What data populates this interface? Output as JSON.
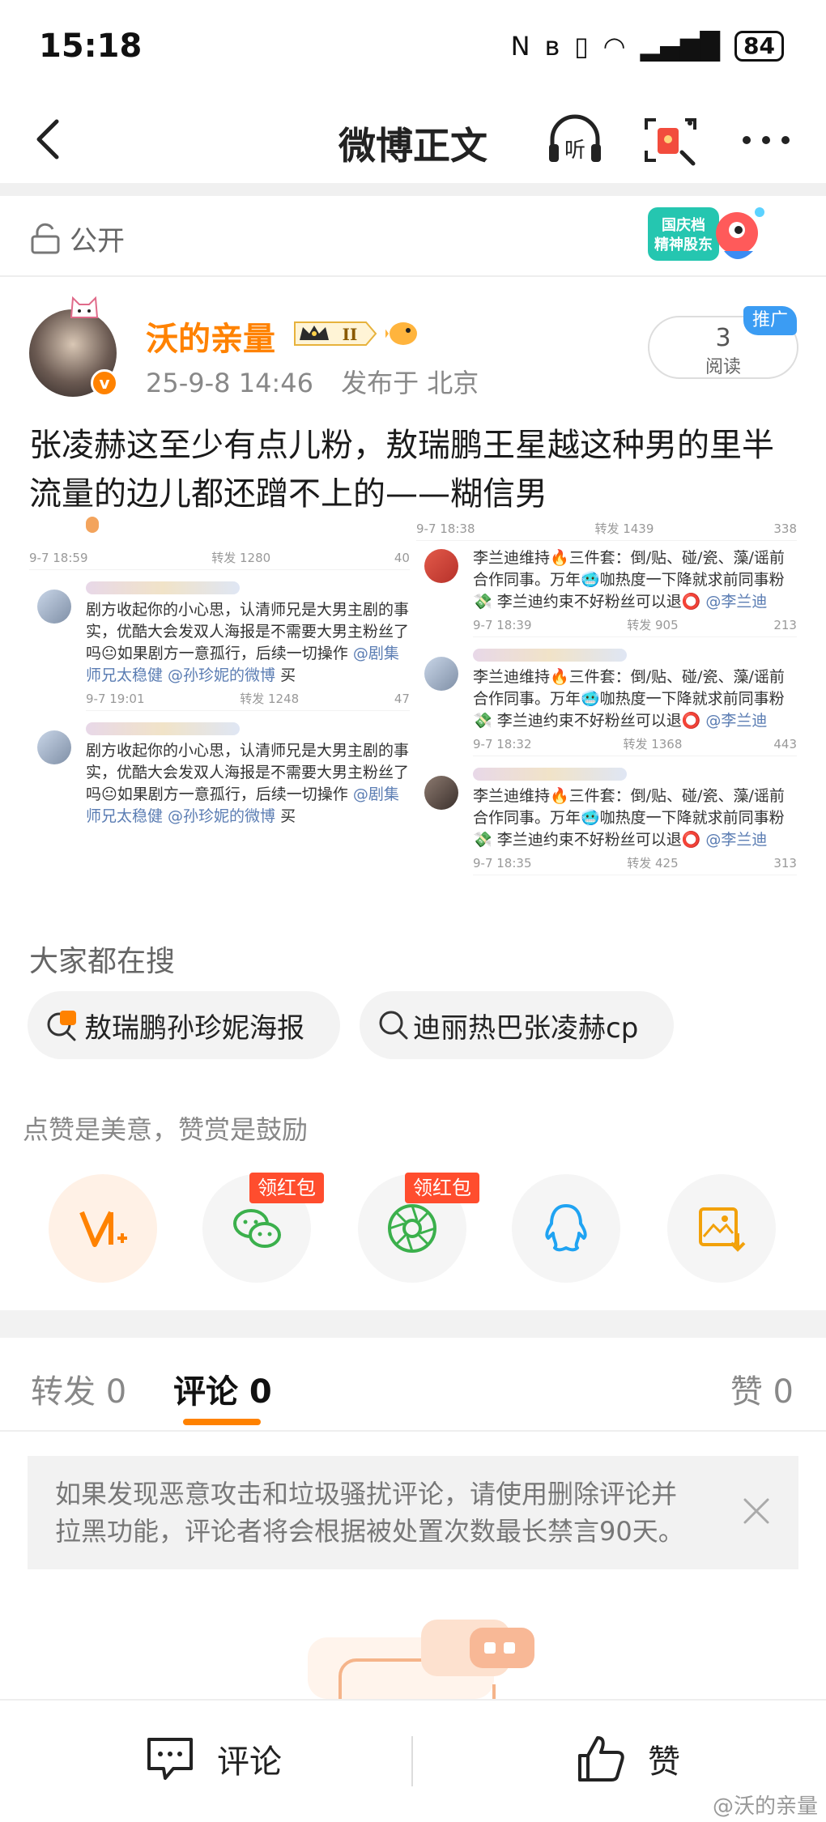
{
  "status_bar": {
    "time": "15:18",
    "battery": "84"
  },
  "nav": {
    "title": "微博正文",
    "listen_label": "听"
  },
  "visibility": {
    "label": "公开"
  },
  "promo_badge": {
    "line1": "国庆档",
    "line2": "精神股东"
  },
  "author": {
    "name": "沃的亲量",
    "level": "II",
    "time": "25-9-8 14:46",
    "location": "发布于 北京"
  },
  "reads": {
    "count": "3",
    "label": "阅读",
    "promo_tag": "推广"
  },
  "post": {
    "text": "张凌赫这至少有点儿粉，敖瑞鹏王星越这种男的里半流量的边儿都还蹭不上的——糊信男"
  },
  "screenshot_left": {
    "top_meta": [
      "9-7 18:59",
      "转发 1280",
      "40"
    ],
    "comment1": {
      "text": "剧方收起你的小心思，认清师兄是大男主剧的事实，优酷大会发双人海报是不需要大男主粉丝了吗😐如果剧方一意孤行，后续一切操作",
      "mention": "@剧集师兄太稳健 @孙珍妮的微博",
      "tail": "买",
      "meta": [
        "9-7 19:01",
        "转发 1248",
        "47"
      ]
    },
    "comment2": {
      "text": "剧方收起你的小心思，认清师兄是大男主剧的事实，优酷大会发双人海报是不需要大男主粉丝了吗😐如果剧方一意孤行，后续一切操作",
      "mention": "@剧集师兄太稳健 @孙珍妮的微博",
      "tail": "买"
    }
  },
  "screenshot_right": {
    "top_meta": [
      "9-7 18:38",
      "转发 1439",
      "338"
    ],
    "comment1": {
      "text": "李兰迪维持🔥三件套：倒/贴、碰/瓷、藻/谣前合作同事。万年🥶咖热度一下降就求前同事粉💸 李兰迪约束不好粉丝可以退⭕",
      "mention": "@李兰迪",
      "meta": [
        "9-7 18:39",
        "转发 905",
        "213"
      ]
    },
    "comment2": {
      "text": "李兰迪维持🔥三件套：倒/贴、碰/瓷、藻/谣前合作同事。万年🥶咖热度一下降就求前同事粉💸 李兰迪约束不好粉丝可以退⭕",
      "mention": "@李兰迪",
      "meta": [
        "9-7 18:32",
        "转发 1368",
        "443"
      ]
    },
    "comment3": {
      "text": "李兰迪维持🔥三件套：倒/贴、碰/瓷、藻/谣前合作同事。万年🥶咖热度一下降就求前同事粉💸 李兰迪约束不好粉丝可以退⭕",
      "mention": "@李兰迪",
      "meta": [
        "9-7 18:35",
        "转发 425",
        "313"
      ]
    }
  },
  "search": {
    "title": "大家都在搜",
    "chips": [
      "敖瑞鹏孙珍妮海报",
      "迪丽热巴张凌赫cp"
    ]
  },
  "reward": {
    "text": "点赞是美意，赞赏是鼓励",
    "red_tag": "领红包"
  },
  "tabs": {
    "forward": "转发 0",
    "comment": "评论 0",
    "like": "赞 0"
  },
  "notice": {
    "text": "如果发现恶意攻击和垃圾骚扰评论，请使用删除评论并拉黑功能，评论者将会根据被处置次数最长禁言90天。"
  },
  "bottom_bar": {
    "comment": "评论",
    "like": "赞",
    "watermark": "@沃的亲量"
  },
  "colors": {
    "accent": "#ff8200",
    "wechat": "#3bb04c",
    "qq": "#1fa3f2",
    "promo": "#3b9cf3",
    "red": "#ff4d2e"
  }
}
